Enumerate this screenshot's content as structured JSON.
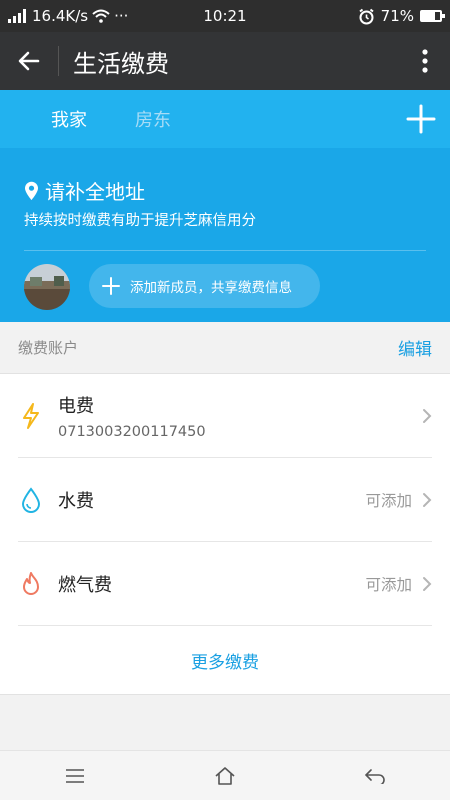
{
  "status_bar": {
    "network_speed": "16.4K/s",
    "more_dots": "···",
    "time": "10:21",
    "battery_percent": "71%",
    "battery_level": 0.71,
    "icons": [
      "signal-icon",
      "wifi-icon",
      "alarm-icon",
      "battery-icon"
    ]
  },
  "app_bar": {
    "title": "生活缴费",
    "back_icon": "arrow-left-icon",
    "menu_icon": "more-vertical-icon"
  },
  "header": {
    "tabs": [
      {
        "label": "我家",
        "active": true
      },
      {
        "label": "房东",
        "active": false
      }
    ],
    "add_icon": "plus-icon",
    "address_label": "请补全地址",
    "address_icon": "location-pin-icon",
    "hint": "持续按时缴费有助于提升芝麻信用分",
    "add_member_label": "添加新成员，共享缴费信息"
  },
  "accounts": {
    "section_title": "缴费账户",
    "edit_label": "编辑",
    "items": [
      {
        "name": "电费",
        "account": "0713003200117450",
        "status": "",
        "icon": "lightning-icon",
        "color": "#f5b81c"
      },
      {
        "name": "水费",
        "account": "",
        "status": "可添加",
        "icon": "water-drop-icon",
        "color": "#21b4e3"
      },
      {
        "name": "燃气费",
        "account": "",
        "status": "可添加",
        "icon": "flame-icon",
        "color": "#ef7a62"
      }
    ],
    "more_label": "更多缴费"
  },
  "nav_bar": {
    "icons": [
      "menu-icon",
      "home-icon",
      "back-icon"
    ]
  },
  "colors": {
    "brand_blue": "#1aa7e8",
    "link_blue": "#1aa0e2",
    "app_bar": "#333436"
  }
}
